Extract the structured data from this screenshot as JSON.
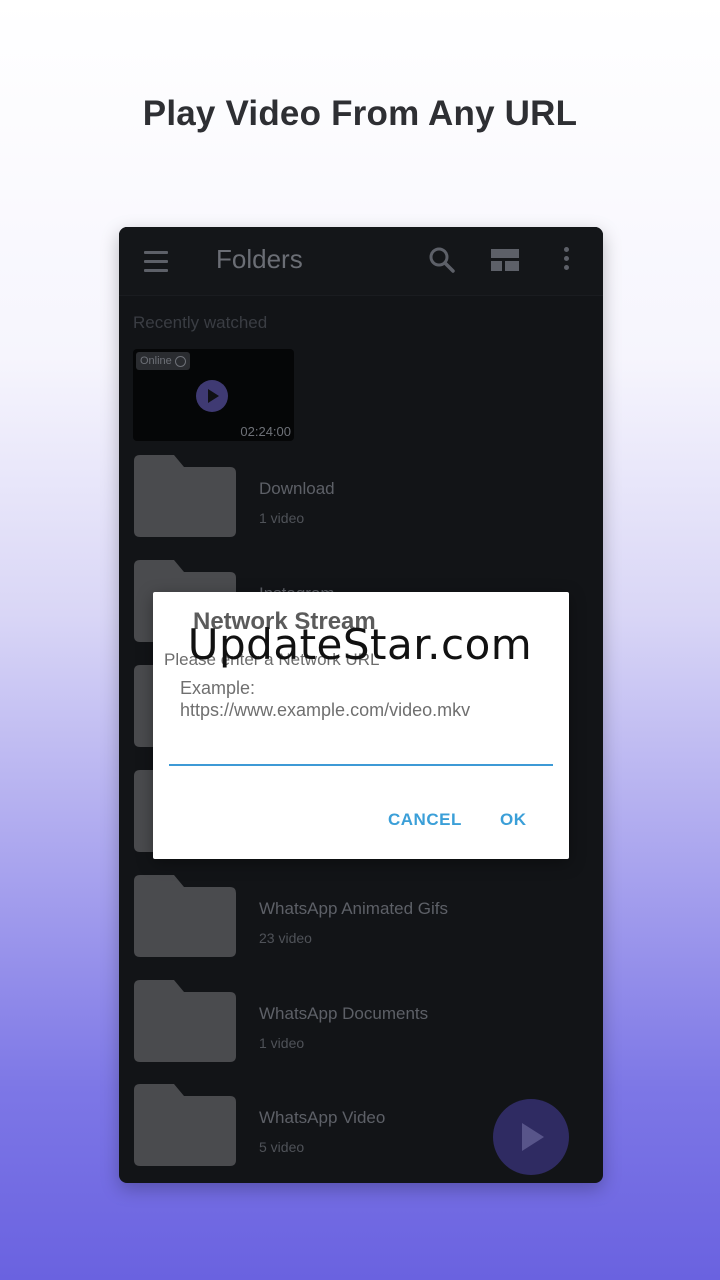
{
  "promo": {
    "title": "Play Video From Any URL"
  },
  "appbar": {
    "title": "Folders",
    "icons": [
      "menu-icon",
      "search-icon",
      "layout-icon",
      "more-vert-icon"
    ]
  },
  "recent": {
    "label": "Recently watched",
    "item": {
      "badge": "Online",
      "duration": "02:24:00"
    }
  },
  "folders": [
    {
      "name": "Download",
      "count": "1 video"
    },
    {
      "name": "Instagram",
      "count": ""
    },
    {
      "name": "",
      "count": ""
    },
    {
      "name": "",
      "count": ""
    },
    {
      "name": "WhatsApp Animated Gifs",
      "count": "23 video"
    },
    {
      "name": "WhatsApp Documents",
      "count": "1 video"
    },
    {
      "name": "WhatsApp Video",
      "count": "5 video"
    }
  ],
  "dialog": {
    "title": "Network Stream",
    "message": "Please enter a Network URL",
    "hint": "Example: https://www.example.com/video.mkv",
    "input_value": "",
    "cancel_label": "CANCEL",
    "ok_label": "OK"
  },
  "watermark": "UpdateStar.com",
  "colors": {
    "accent": "#3b9fd8",
    "app_background": "#121417",
    "fab": "#2f2b62"
  }
}
